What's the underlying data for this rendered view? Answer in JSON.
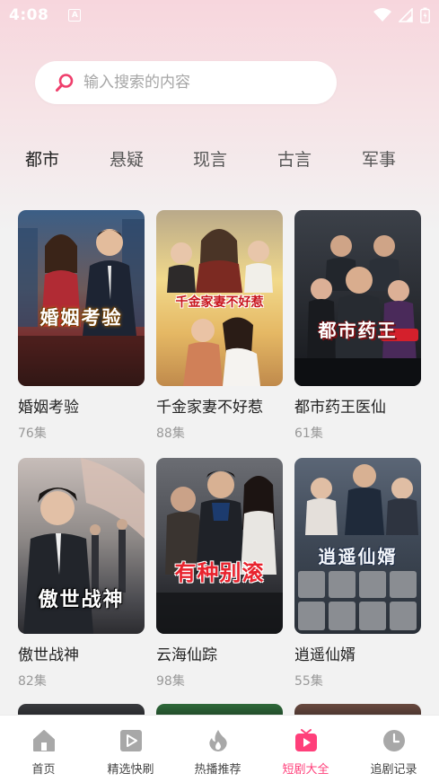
{
  "status_bar": {
    "time": "4:08",
    "notif_letter": "A"
  },
  "search": {
    "placeholder": "输入搜索的内容",
    "value": ""
  },
  "tabs": [
    {
      "label": "都市",
      "active": true
    },
    {
      "label": "悬疑",
      "active": false
    },
    {
      "label": "现言",
      "active": false
    },
    {
      "label": "古言",
      "active": false
    },
    {
      "label": "军事",
      "active": false
    }
  ],
  "dramas": [
    {
      "title": "婚姻考验",
      "episodes": "76集",
      "poster_text": "婚姻考验"
    },
    {
      "title": "千金家妻不好惹",
      "episodes": "88集",
      "poster_text": "千金家妻不好惹"
    },
    {
      "title": "都市药王医仙",
      "episodes": "61集",
      "poster_text": "都市药王"
    },
    {
      "title": "傲世战神",
      "episodes": "82集",
      "poster_text": "傲世战神"
    },
    {
      "title": "云海仙踪",
      "episodes": "98集",
      "poster_text": "有种别滚"
    },
    {
      "title": "逍遥仙婿",
      "episodes": "55集",
      "poster_text": "逍遥仙婿"
    }
  ],
  "bottom_nav": [
    {
      "label": "首页",
      "icon": "home-icon",
      "active": false
    },
    {
      "label": "精选快刷",
      "icon": "play-square-icon",
      "active": false
    },
    {
      "label": "热播推荐",
      "icon": "flame-icon",
      "active": false
    },
    {
      "label": "短剧大全",
      "icon": "tv-play-icon",
      "active": true
    },
    {
      "label": "追剧记录",
      "icon": "clock-icon",
      "active": false
    }
  ],
  "colors": {
    "accent": "#ff3f7a",
    "tab_highlight": "#ff4f8b",
    "icon_gray": "#a8a8a8"
  }
}
